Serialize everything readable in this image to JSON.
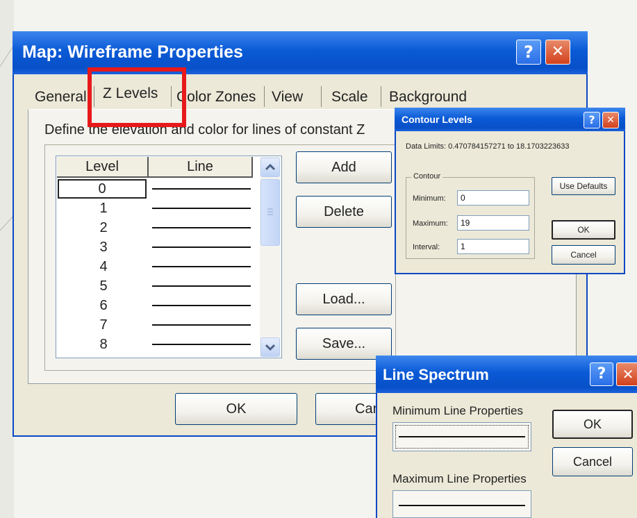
{
  "main_dialog": {
    "title": "Map: Wireframe Properties",
    "help_glyph": "?",
    "close_glyph": "✕",
    "tabs": [
      "General",
      "Z Levels",
      "Color Zones",
      "View",
      "Scale",
      "Background"
    ],
    "selected_tab": "Z Levels",
    "description": "Define the elevation and color for lines of constant Z",
    "columns": [
      "Level",
      "Line"
    ],
    "levels": [
      "0",
      "1",
      "2",
      "3",
      "4",
      "5",
      "6",
      "7",
      "8"
    ],
    "buttons": {
      "add": "Add",
      "delete": "Delete",
      "load": "Load...",
      "save": "Save...",
      "ok": "OK",
      "cancel": "Cancel"
    }
  },
  "contour_dialog": {
    "title": "Contour Levels",
    "help_glyph": "?",
    "close_glyph": "✕",
    "data_limits": "Data Limits:  0.470784157271  to  18.1703223633",
    "group_label": "Contour",
    "minimum_label": "Minimum:",
    "minimum_value": "0",
    "maximum_label": "Maximum:",
    "maximum_value": "19",
    "interval_label": "Interval:",
    "interval_value": "1",
    "use_defaults": "Use Defaults",
    "ok": "OK",
    "cancel": "Cancel"
  },
  "spectrum_dialog": {
    "title": "Line Spectrum",
    "help_glyph": "?",
    "close_glyph": "✕",
    "min_label": "Minimum Line Properties",
    "max_label": "Maximum Line Properties",
    "ok": "OK",
    "cancel": "Cancel"
  },
  "icons": [
    "help-icon",
    "close-icon",
    "scroll-up-icon",
    "scroll-down-icon",
    "scroll-thumb-grip-icon"
  ],
  "colors": {
    "title_bar": "#0a5ad6",
    "dialog_face": "#ece9d8",
    "highlight_box": "#e8191b",
    "close_button": "#d2401c"
  }
}
